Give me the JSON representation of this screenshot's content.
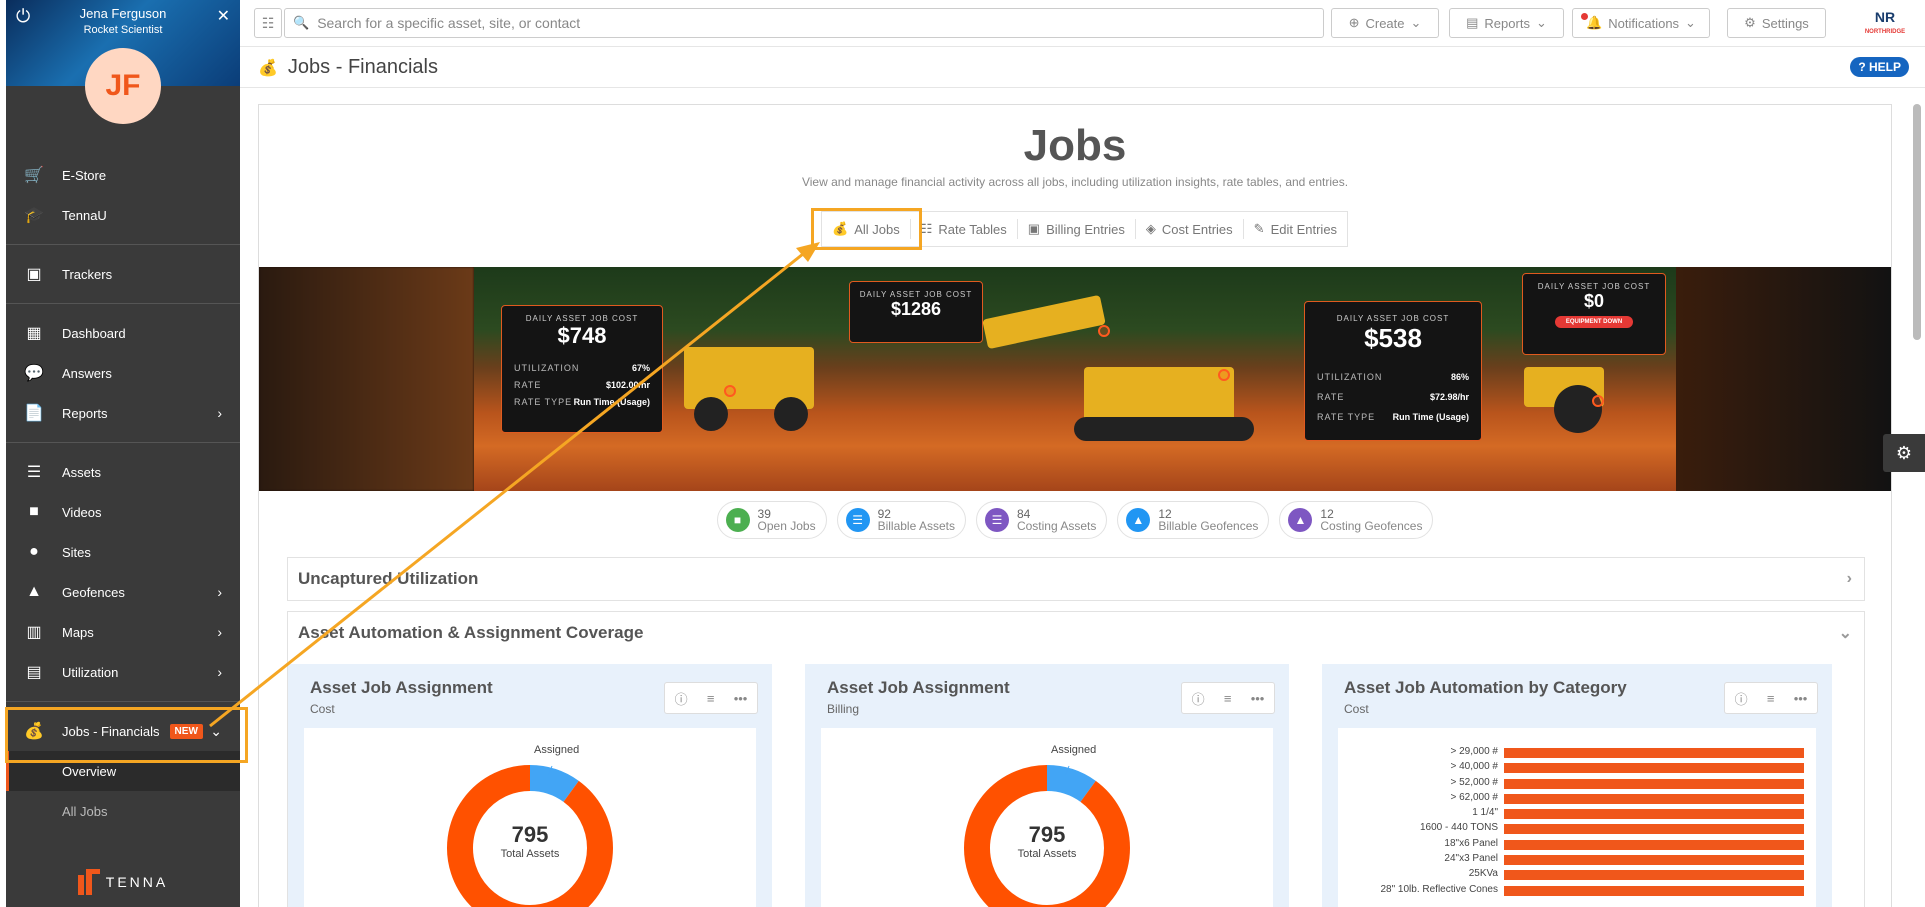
{
  "user": {
    "name": "Jena Ferguson",
    "role": "Rocket Scientist",
    "initials": "JF"
  },
  "sidebar": {
    "items": [
      {
        "label": "E-Store",
        "icon": "cart-icon"
      },
      {
        "label": "TennaU",
        "icon": "graduation-cap-icon"
      },
      {
        "label": "Trackers",
        "icon": "chip-icon"
      },
      {
        "label": "Dashboard",
        "icon": "dashboard-icon"
      },
      {
        "label": "Answers",
        "icon": "chat-icon"
      },
      {
        "label": "Reports",
        "icon": "document-icon"
      },
      {
        "label": "Assets",
        "icon": "list-icon"
      },
      {
        "label": "Videos",
        "icon": "video-icon"
      },
      {
        "label": "Sites",
        "icon": "pin-icon"
      },
      {
        "label": "Geofences",
        "icon": "shapes-icon"
      },
      {
        "label": "Maps",
        "icon": "map-icon"
      },
      {
        "label": "Utilization",
        "icon": "bar-chart-icon"
      },
      {
        "label": "Jobs - Financials",
        "icon": "money-bag-icon",
        "badge": "NEW"
      }
    ],
    "sub_items": [
      "Overview",
      "All Jobs"
    ],
    "logo": "TENNA"
  },
  "topbar": {
    "search_placeholder": "Search for a specific asset, site, or contact",
    "create": "Create",
    "reports": "Reports",
    "notifications": "Notifications",
    "settings": "Settings",
    "logo_text": "NR",
    "logo_sub": "NORTHRIDGE"
  },
  "page": {
    "title": "Jobs - Financials",
    "help": "HELP"
  },
  "jobs": {
    "title": "Jobs",
    "subtitle": "View and manage financial activity across all jobs, including utilization insights, rate tables, and entries.",
    "tabs": [
      "All Jobs",
      "Rate Tables",
      "Billing Entries",
      "Cost Entries",
      "Edit Entries"
    ]
  },
  "hero": {
    "card1": {
      "label": "DAILY ASSET JOB COST",
      "value": "$748",
      "utilization_label": "UTILIZATION",
      "utilization": "67%",
      "rate_label": "RATE",
      "rate": "$102.00/hr",
      "rate_type_label": "RATE TYPE",
      "rate_type": "Run Time (Usage)"
    },
    "card2": {
      "label": "DAILY ASSET JOB COST",
      "value": "$1286"
    },
    "card3": {
      "label": "DAILY ASSET JOB COST",
      "value": "$538",
      "utilization_label": "UTILIZATION",
      "utilization": "86%",
      "rate_label": "RATE",
      "rate": "$72.98/hr",
      "rate_type_label": "RATE TYPE",
      "rate_type": "Run Time (Usage)"
    },
    "card4": {
      "label": "DAILY ASSET JOB COST",
      "value": "$0",
      "button": "EQUIPMENT DOWN"
    }
  },
  "stats": [
    {
      "count": "39",
      "label": "Open Jobs",
      "color": "#4caf50"
    },
    {
      "count": "92",
      "label": "Billable Assets",
      "color": "#2196f3"
    },
    {
      "count": "84",
      "label": "Costing Assets",
      "color": "#7e57c2"
    },
    {
      "count": "12",
      "label": "Billable Geofences",
      "color": "#2196f3"
    },
    {
      "count": "12",
      "label": "Costing Geofences",
      "color": "#7e57c2"
    }
  ],
  "sections": {
    "uncaptured": "Uncaptured Utilization",
    "coverage": "Asset Automation & Assignment Coverage"
  },
  "panels": [
    {
      "title": "Asset Job Assignment",
      "sub": "Cost",
      "center_value": "795",
      "center_label": "Total Assets",
      "slice_label": "Assigned"
    },
    {
      "title": "Asset Job Assignment",
      "sub": "Billing",
      "center_value": "795",
      "center_label": "Total Assets",
      "slice_label": "Assigned"
    },
    {
      "title": "Asset Job Automation by Category",
      "sub": "Cost"
    }
  ],
  "chart_data": [
    {
      "type": "pie",
      "labels": [
        "Assigned",
        "Unassigned"
      ],
      "values": [
        0.1,
        0.9
      ],
      "colors": [
        "#42a5f5",
        "#ff5100"
      ],
      "title": ""
    },
    {
      "type": "pie",
      "labels": [
        "Assigned",
        "Unassigned"
      ],
      "values": [
        0.1,
        0.9
      ],
      "colors": [
        "#42a5f5",
        "#ff5100"
      ],
      "title": ""
    },
    {
      "type": "bar",
      "categories": [
        "> 29,000 #",
        "> 40,000 #",
        "> 52,000 #",
        "> 62,000 #",
        "1 1/4\"",
        "1600 - 440 TONS",
        "18\"x6 Panel",
        "24\"x3 Panel",
        "25KVa",
        "28\" 10lb. Reflective Cones"
      ],
      "values": [
        1,
        1,
        1,
        1,
        1,
        1,
        1,
        1,
        1,
        1
      ],
      "title": ""
    }
  ]
}
